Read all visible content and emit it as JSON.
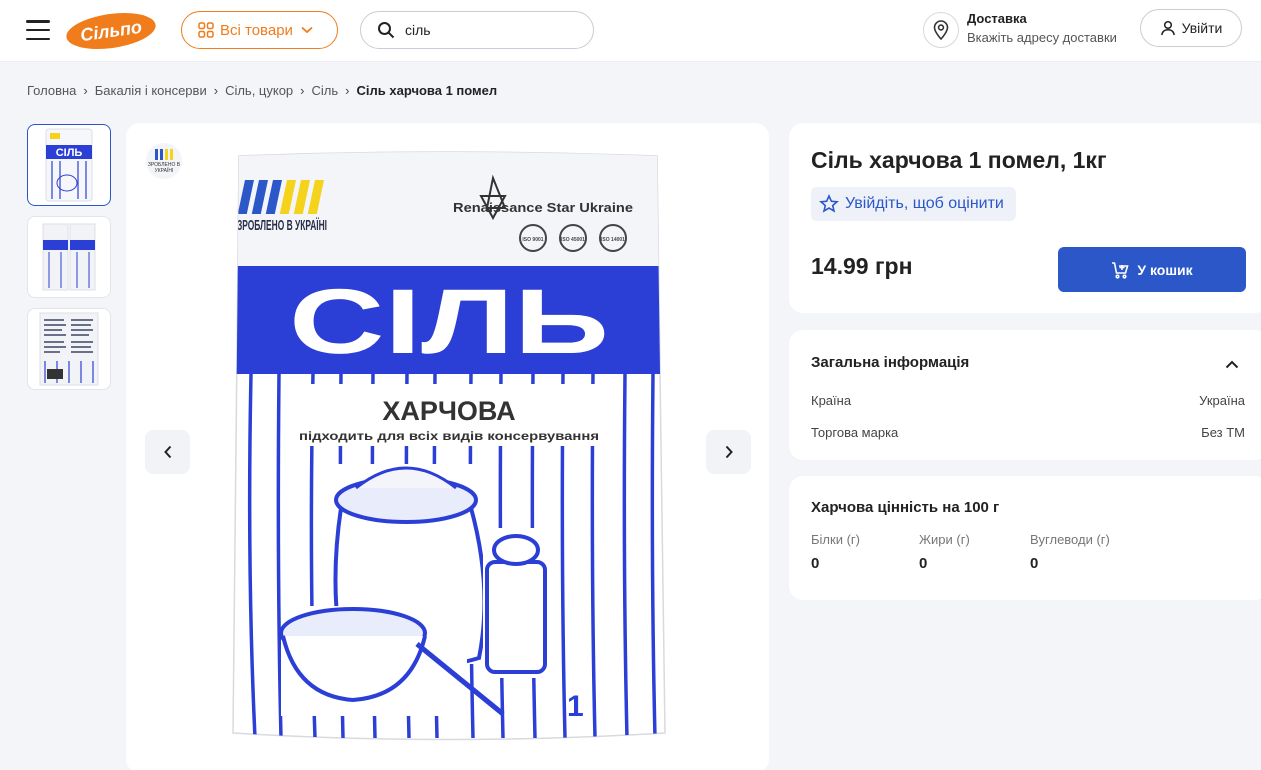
{
  "header": {
    "logo_text": "Сільпо",
    "catalog_label": "Всі товари",
    "search_value": "сіль",
    "delivery_title": "Доставка",
    "delivery_subtitle": "Вкажіть адресу доставки",
    "login_label": "Увійти",
    "accent_color": "#f07c1c"
  },
  "breadcrumb": [
    "Головна",
    "Бакалія і консерви",
    "Сіль, цукор",
    "Сіль",
    "Сіль харчова 1 помел"
  ],
  "gallery": {
    "badge_text": "ЗРОБЛЕНО В УКРАЇНІ",
    "package": {
      "made_in": "ЗРОБЛЕНО В УКРАЇНІ",
      "brand": "Renaissance Star Ukraine",
      "iso_labels": [
        "ISO 9001",
        "ISO 45001",
        "ISO 14001"
      ],
      "big_word": "СІЛЬ",
      "subtitle": "ХАРЧОВА",
      "tagline": "підходить для всіх видів консервування",
      "number": "1"
    }
  },
  "product": {
    "title": "Сіль харчова 1 помел, 1кг",
    "rate_label": "Увійдіть, щоб оцінити",
    "price": "14.99 грн",
    "cart_label": "У кошик",
    "button_color": "#2b57c8"
  },
  "general_info": {
    "title": "Загальна інформація",
    "rows": [
      {
        "key": "Країна",
        "value": "Україна"
      },
      {
        "key": "Торгова марка",
        "value": "Без ТМ"
      }
    ]
  },
  "nutrition": {
    "title": "Харчова цінність на 100 г",
    "items": [
      {
        "key": "Білки (г)",
        "value": "0"
      },
      {
        "key": "Жири (г)",
        "value": "0"
      },
      {
        "key": "Вуглеводи (г)",
        "value": "0"
      }
    ]
  }
}
